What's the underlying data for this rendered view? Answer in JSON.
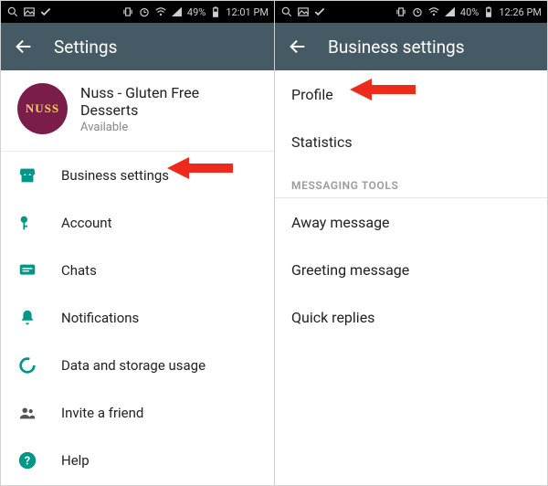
{
  "left": {
    "statusbar": {
      "battery": "49%",
      "time": "12:01 PM"
    },
    "actionbar": {
      "title": "Settings"
    },
    "profile": {
      "name": "Nuss - Gluten Free Desserts",
      "status": "Available",
      "avatar_text": "NUSS"
    },
    "items": [
      {
        "label": "Business settings"
      },
      {
        "label": "Account"
      },
      {
        "label": "Chats"
      },
      {
        "label": "Notifications"
      },
      {
        "label": "Data and storage usage"
      },
      {
        "label": "Invite a friend"
      },
      {
        "label": "Help"
      }
    ]
  },
  "right": {
    "statusbar": {
      "battery": "40%",
      "time": "12:26 PM"
    },
    "actionbar": {
      "title": "Business settings"
    },
    "sections": {
      "top": [
        {
          "label": "Profile"
        },
        {
          "label": "Statistics"
        }
      ],
      "messaging_header": "MESSAGING TOOLS",
      "messaging": [
        {
          "label": "Away message"
        },
        {
          "label": "Greeting message"
        },
        {
          "label": "Quick replies"
        }
      ]
    }
  }
}
